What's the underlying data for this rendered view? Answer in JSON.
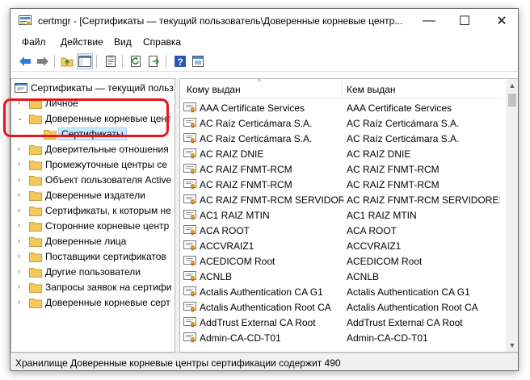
{
  "window": {
    "title": "certmgr - [Сертификаты — текущий пользователь\\Доверенные корневые центр...",
    "minimize_glyph": "—",
    "maximize_glyph": "☐",
    "close_glyph": "✕"
  },
  "menu": [
    "Файл",
    "Действие",
    "Вид",
    "Справка"
  ],
  "toolbar_icons": [
    "back-arrow-icon",
    "forward-arrow-icon",
    "up-folder-icon",
    "console-tree-icon",
    "properties-icon",
    "refresh-icon",
    "export-list-icon",
    "help-icon",
    "console-icon"
  ],
  "tree": {
    "root": "Сертификаты — текущий польз",
    "items": [
      "Личное",
      "Доверенные корневые цент",
      "Сертификаты",
      "Доверительные отношения",
      "Промежуточные центры се",
      "Объект пользователя Active",
      "Доверенные издатели",
      "Сертификаты, к которым не",
      "Сторонние корневые центр",
      "Доверенные лица",
      "Поставщики сертификатов",
      "Другие пользователи",
      "Запросы заявок на сертифи",
      "Доверенные корневые серт"
    ]
  },
  "list": {
    "columns": [
      "Кому выдан",
      "Кем выдан"
    ],
    "sort_glyph": "^",
    "rows": [
      [
        "AAA Certificate Services",
        "AAA Certificate Services"
      ],
      [
        "AC Raíz Certicámara S.A.",
        "AC Raíz Certicámara S.A."
      ],
      [
        "AC Raíz Certicámara S.A.",
        "AC Raíz Certicámara S.A."
      ],
      [
        "AC RAIZ DNIE",
        "AC RAIZ DNIE"
      ],
      [
        "AC RAIZ FNMT-RCM",
        "AC RAIZ FNMT-RCM"
      ],
      [
        "AC RAIZ FNMT-RCM",
        "AC RAIZ FNMT-RCM"
      ],
      [
        "AC RAIZ FNMT-RCM SERVIDORE...",
        "AC RAIZ FNMT-RCM SERVIDORES..."
      ],
      [
        "AC1 RAIZ MTIN",
        "AC1 RAIZ MTIN"
      ],
      [
        "ACA ROOT",
        "ACA ROOT"
      ],
      [
        "ACCVRAIZ1",
        "ACCVRAIZ1"
      ],
      [
        "ACEDICOM Root",
        "ACEDICOM Root"
      ],
      [
        "ACNLB",
        "ACNLB"
      ],
      [
        "Actalis Authentication CA G1",
        "Actalis Authentication CA G1"
      ],
      [
        "Actalis Authentication Root CA",
        "Actalis Authentication Root CA"
      ],
      [
        "AddTrust External CA Root",
        "AddTrust External CA Root"
      ],
      [
        "Admin-CA-CD-T01",
        "Admin-CA-CD-T01"
      ]
    ]
  },
  "status": "Хранилище Доверенные корневые центры сертификации содержит 490",
  "colors": {
    "highlight": "#e8141c",
    "selection": "#cce8ff",
    "folder": "#f4c95a"
  }
}
